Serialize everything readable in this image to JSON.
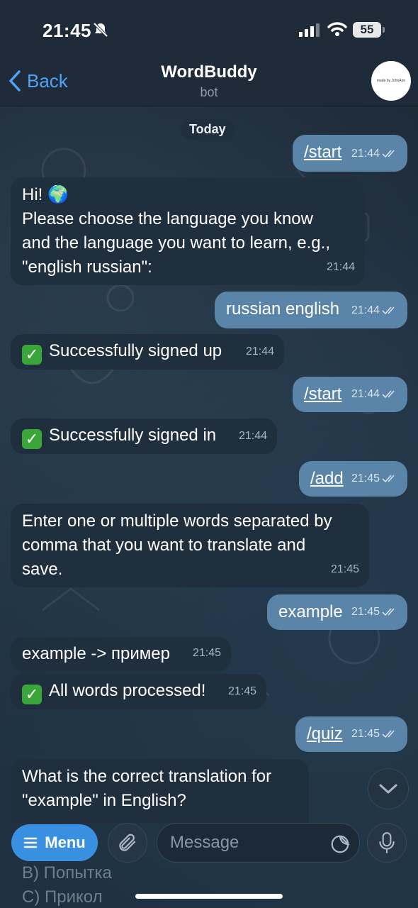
{
  "status": {
    "time": "21:45",
    "battery": "55"
  },
  "header": {
    "back": "Back",
    "title": "WordBuddy",
    "subtitle": "bot",
    "avatar_text": "made by JohnAnn"
  },
  "chat": {
    "date": "Today",
    "messages": [
      {
        "dir": "out",
        "text": "/start",
        "time": "21:44"
      },
      {
        "dir": "in",
        "line1": "Hi! 🌍",
        "line2": "Please choose the language you know",
        "line3": "and the language you want to learn, e.g.,",
        "line4": "\"english russian\":",
        "time": "21:44"
      },
      {
        "dir": "out",
        "text": "russian english",
        "time": "21:44"
      },
      {
        "dir": "in",
        "text": "Successfully signed up",
        "time": "21:44"
      },
      {
        "dir": "out",
        "text": "/start",
        "time": "21:44"
      },
      {
        "dir": "in",
        "text": "Successfully signed in",
        "time": "21:44"
      },
      {
        "dir": "out",
        "text": "/add",
        "time": "21:45"
      },
      {
        "dir": "in",
        "line1": "Enter one or multiple words separated by",
        "line2": "comma that you want to translate and",
        "line3": "save.",
        "time": "21:45"
      },
      {
        "dir": "out",
        "text": "example",
        "time": "21:45"
      },
      {
        "dir": "in",
        "text": "example -> пример",
        "time": "21:45"
      },
      {
        "dir": "in",
        "text": "All words processed!",
        "time": "21:45"
      },
      {
        "dir": "out",
        "text": "/quiz",
        "time": "21:45"
      },
      {
        "dir": "in",
        "line1": "What is the correct translation for",
        "line2": "\"example\" in English?"
      }
    ],
    "hidden_options": [
      "B) Попытка",
      "C) Прикол"
    ]
  },
  "input": {
    "menu": "Menu",
    "placeholder": "Message"
  }
}
